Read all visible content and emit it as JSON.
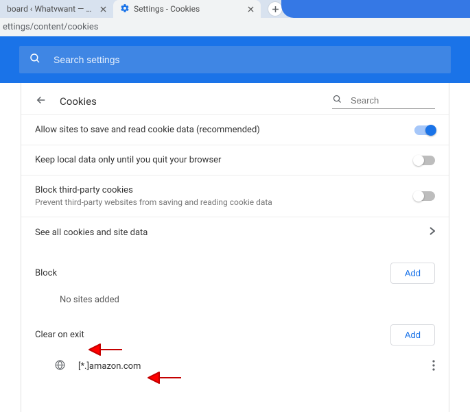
{
  "tabs": {
    "inactive": {
      "title": "board ‹ Whatvwant — Wor…"
    },
    "active": {
      "title": "Settings - Cookies"
    }
  },
  "address_bar": {
    "path": "ettings/content/cookies"
  },
  "search_banner": {
    "placeholder": "Search settings"
  },
  "header": {
    "title": "Cookies",
    "search_placeholder": "Search"
  },
  "rows": {
    "allow": {
      "title": "Allow sites to save and read cookie data (recommended)"
    },
    "keep_local": {
      "title": "Keep local data only until you quit your browser"
    },
    "block_third": {
      "title": "Block third-party cookies",
      "sub": "Prevent third-party websites from saving and reading cookie data"
    },
    "see_all": {
      "title": "See all cookies and site data"
    }
  },
  "sections": {
    "block": {
      "title": "Block",
      "add_label": "Add",
      "empty": "No sites added"
    },
    "clear_on_exit": {
      "title": "Clear on exit",
      "add_label": "Add",
      "site": "[*.]amazon.com"
    }
  }
}
